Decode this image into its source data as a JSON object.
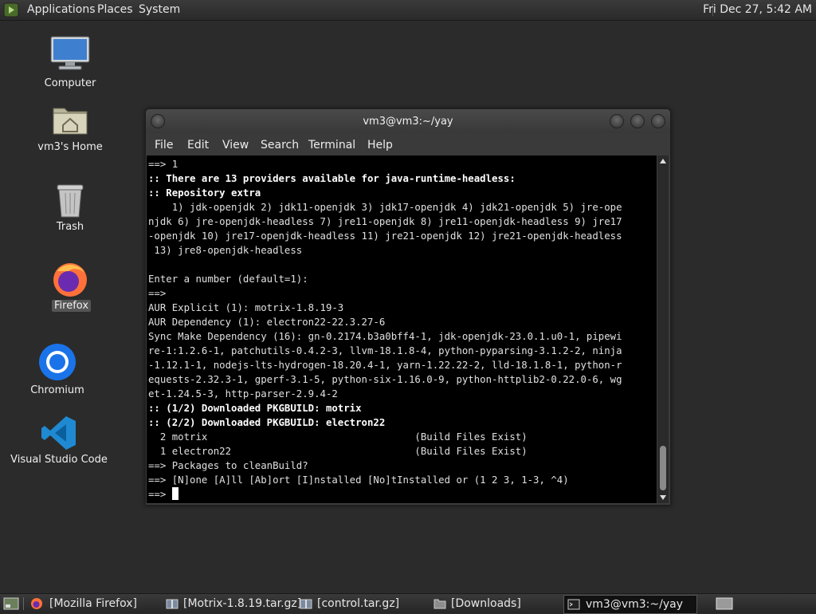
{
  "top_panel": {
    "menu": [
      "Applications",
      "Places",
      "System"
    ],
    "clock": "Fri Dec 27,  5:42 AM"
  },
  "desktop": {
    "icons": [
      {
        "label": "Computer",
        "icon": "computer-icon"
      },
      {
        "label": "vm3's Home",
        "icon": "home-folder-icon"
      },
      {
        "label": "Trash",
        "icon": "trash-icon"
      },
      {
        "label": "Firefox",
        "icon": "firefox-icon"
      },
      {
        "label": "Chromium",
        "icon": "chromium-icon"
      },
      {
        "label": "Visual Studio Code",
        "icon": "vscode-icon"
      }
    ]
  },
  "terminal": {
    "title": "vm3@vm3:~/yay",
    "menu": [
      "File",
      "Edit",
      "View",
      "Search",
      "Terminal",
      "Help"
    ],
    "lines": [
      {
        "text": "==> 1",
        "bold": false
      },
      {
        "text": ":: There are 13 providers available for java-runtime-headless:",
        "bold": true
      },
      {
        "text": ":: Repository extra",
        "bold": true
      },
      {
        "text": "    1) jdk-openjdk 2) jdk11-openjdk 3) jdk17-openjdk 4) jdk21-openjdk 5) jre-ope",
        "bold": false
      },
      {
        "text": "njdk 6) jre-openjdk-headless 7) jre11-openjdk 8) jre11-openjdk-headless 9) jre17",
        "bold": false
      },
      {
        "text": "-openjdk 10) jre17-openjdk-headless 11) jre21-openjdk 12) jre21-openjdk-headless",
        "bold": false
      },
      {
        "text": " 13) jre8-openjdk-headless",
        "bold": false
      },
      {
        "text": "",
        "bold": false
      },
      {
        "text": "Enter a number (default=1):",
        "bold": false
      },
      {
        "text": "==>",
        "bold": false
      },
      {
        "text": "AUR Explicit (1): motrix-1.8.19-3",
        "bold": false
      },
      {
        "text": "AUR Dependency (1): electron22-22.3.27-6",
        "bold": false
      },
      {
        "text": "Sync Make Dependency (16): gn-0.2174.b3a0bff4-1, jdk-openjdk-23.0.1.u0-1, pipewi",
        "bold": false
      },
      {
        "text": "re-1:1.2.6-1, patchutils-0.4.2-3, llvm-18.1.8-4, python-pyparsing-3.1.2-2, ninja",
        "bold": false
      },
      {
        "text": "-1.12.1-1, nodejs-lts-hydrogen-18.20.4-1, yarn-1.22.22-2, lld-18.1.8-1, python-r",
        "bold": false
      },
      {
        "text": "equests-2.32.3-1, gperf-3.1-5, python-six-1.16.0-9, python-httplib2-0.22.0-6, wg",
        "bold": false
      },
      {
        "text": "et-1.24.5-3, http-parser-2.9.4-2",
        "bold": false
      },
      {
        "text": ":: (1/2) Downloaded PKGBUILD: motrix",
        "bold": true
      },
      {
        "text": ":: (2/2) Downloaded PKGBUILD: electron22",
        "bold": true
      },
      {
        "text": "  2 motrix                                   (Build Files Exist)",
        "bold": false
      },
      {
        "text": "  1 electron22                               (Build Files Exist)",
        "bold": false
      },
      {
        "text": "==> Packages to cleanBuild?",
        "bold": false
      },
      {
        "text": "==> [N]one [A]ll [Ab]ort [I]nstalled [No]tInstalled or (1 2 3, 1-3, ^4)",
        "bold": false
      }
    ],
    "prompt": "==> "
  },
  "taskbar": {
    "tasks": [
      {
        "label": "[Mozilla Firefox]",
        "icon": "firefox-icon",
        "active": false
      },
      {
        "label": "[Motrix-1.8.19.tar.gz]",
        "icon": "archive-icon",
        "active": false
      },
      {
        "label": "[control.tar.gz]",
        "icon": "archive-icon",
        "active": false
      },
      {
        "label": "[Downloads]",
        "icon": "folder-icon",
        "active": false
      },
      {
        "label": "vm3@vm3:~/yay",
        "icon": "terminal-icon",
        "active": true
      }
    ]
  }
}
